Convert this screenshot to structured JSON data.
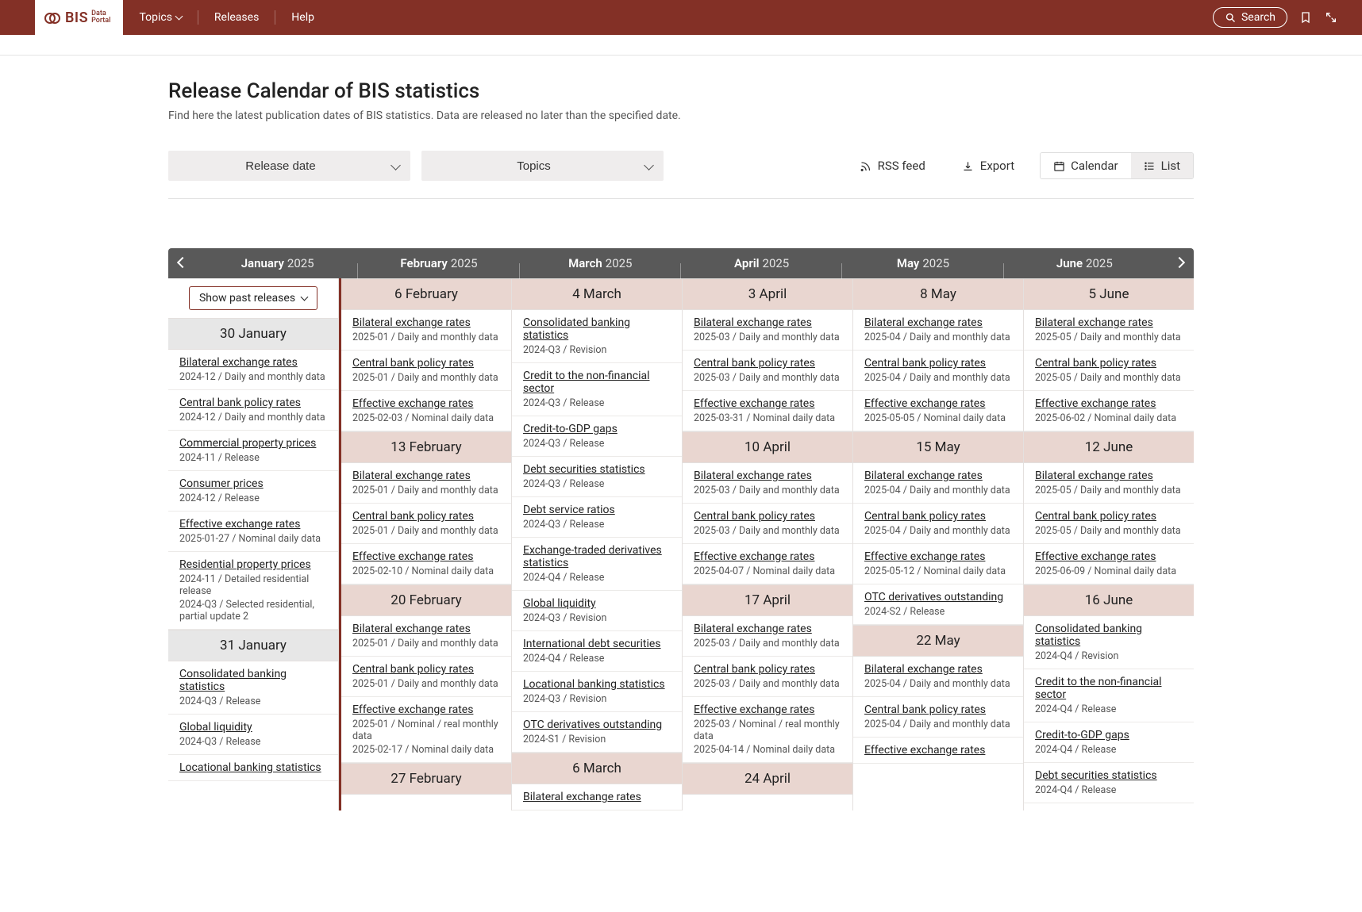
{
  "nav": {
    "brand_main": "BIS",
    "brand_sub1": "Data",
    "brand_sub2": "Portal",
    "topics": "Topics",
    "releases": "Releases",
    "help": "Help",
    "search": "Search"
  },
  "page": {
    "title": "Release Calendar of BIS statistics",
    "subtitle": "Find here the latest publication dates of BIS statistics. Data are released no later than the specified date."
  },
  "filters": {
    "release_date": "Release date",
    "topics": "Topics",
    "rss": "RSS feed",
    "export": "Export",
    "calendar": "Calendar",
    "list": "List"
  },
  "calendar": {
    "show_past": "Show past releases",
    "months": [
      {
        "name": "January",
        "year": "2025"
      },
      {
        "name": "February",
        "year": "2025"
      },
      {
        "name": "March",
        "year": "2025"
      },
      {
        "name": "April",
        "year": "2025"
      },
      {
        "name": "May",
        "year": "2025"
      },
      {
        "name": "June",
        "year": "2025"
      }
    ],
    "columns": [
      {
        "special": "past_toggle",
        "groups": [
          {
            "date": "30 January",
            "muted": true,
            "items": [
              {
                "t": "Bilateral exchange rates",
                "m": [
                  "2024-12 / Daily and monthly data"
                ]
              },
              {
                "t": "Central bank policy rates",
                "m": [
                  "2024-12 / Daily and monthly data"
                ]
              },
              {
                "t": "Commercial property prices",
                "m": [
                  "2024-11 / Release"
                ]
              },
              {
                "t": "Consumer prices",
                "m": [
                  "2024-12 / Release"
                ]
              },
              {
                "t": "Effective exchange rates",
                "m": [
                  "2025-01-27 / Nominal daily data"
                ]
              },
              {
                "t": "Residential property prices",
                "m": [
                  "2024-11 / Detailed residential release",
                  "2024-Q3 / Selected residential, partial update 2"
                ]
              }
            ]
          },
          {
            "date": "31 January",
            "muted": true,
            "items": [
              {
                "t": "Consolidated banking statistics",
                "m": [
                  "2024-Q3 / Release"
                ]
              },
              {
                "t": "Global liquidity",
                "m": [
                  "2024-Q3 / Release"
                ]
              },
              {
                "t": "Locational banking statistics",
                "m": []
              }
            ]
          }
        ]
      },
      {
        "groups": [
          {
            "date": "6 February",
            "items": [
              {
                "t": "Bilateral exchange rates",
                "m": [
                  "2025-01 / Daily and monthly data"
                ]
              },
              {
                "t": "Central bank policy rates",
                "m": [
                  "2025-01 / Daily and monthly data"
                ]
              },
              {
                "t": "Effective exchange rates",
                "m": [
                  "2025-02-03 / Nominal daily data"
                ]
              }
            ]
          },
          {
            "date": "13 February",
            "items": [
              {
                "t": "Bilateral exchange rates",
                "m": [
                  "2025-01 / Daily and monthly data"
                ]
              },
              {
                "t": "Central bank policy rates",
                "m": [
                  "2025-01 / Daily and monthly data"
                ]
              },
              {
                "t": "Effective exchange rates",
                "m": [
                  "2025-02-10 / Nominal daily data"
                ]
              }
            ]
          },
          {
            "date": "20 February",
            "items": [
              {
                "t": "Bilateral exchange rates",
                "m": [
                  "2025-01 / Daily and monthly data"
                ]
              },
              {
                "t": "Central bank policy rates",
                "m": [
                  "2025-01 / Daily and monthly data"
                ]
              },
              {
                "t": "Effective exchange rates",
                "m": [
                  "2025-01 / Nominal / real monthly data",
                  "2025-02-17 / Nominal daily data"
                ]
              }
            ]
          },
          {
            "date": "27 February",
            "items": []
          }
        ]
      },
      {
        "groups": [
          {
            "date": "4 March",
            "items": [
              {
                "t": "Consolidated banking statistics",
                "m": [
                  "2024-Q3 / Revision"
                ]
              },
              {
                "t": "Credit to the non-financial sector",
                "m": [
                  "2024-Q3 / Release"
                ]
              },
              {
                "t": "Credit-to-GDP gaps",
                "m": [
                  "2024-Q3 / Release"
                ]
              },
              {
                "t": "Debt securities statistics",
                "m": [
                  "2024-Q3 / Release"
                ]
              },
              {
                "t": "Debt service ratios",
                "m": [
                  "2024-Q3 / Release"
                ]
              },
              {
                "t": "Exchange-traded derivatives statistics",
                "m": [
                  "2024-Q4 / Release"
                ]
              },
              {
                "t": "Global liquidity",
                "m": [
                  "2024-Q3 / Revision"
                ]
              },
              {
                "t": "International debt securities",
                "m": [
                  "2024-Q4 / Release"
                ]
              },
              {
                "t": "Locational banking statistics",
                "m": [
                  "2024-Q3 / Revision"
                ]
              },
              {
                "t": "OTC derivatives outstanding",
                "m": [
                  "2024-S1 / Revision"
                ]
              }
            ]
          },
          {
            "date": "6 March",
            "items": [
              {
                "t": "Bilateral exchange rates",
                "m": []
              }
            ]
          }
        ]
      },
      {
        "groups": [
          {
            "date": "3 April",
            "items": [
              {
                "t": "Bilateral exchange rates",
                "m": [
                  "2025-03 / Daily and monthly data"
                ]
              },
              {
                "t": "Central bank policy rates",
                "m": [
                  "2025-03 / Daily and monthly data"
                ]
              },
              {
                "t": "Effective exchange rates",
                "m": [
                  "2025-03-31 / Nominal daily data"
                ]
              }
            ]
          },
          {
            "date": "10 April",
            "items": [
              {
                "t": "Bilateral exchange rates",
                "m": [
                  "2025-03 / Daily and monthly data"
                ]
              },
              {
                "t": "Central bank policy rates",
                "m": [
                  "2025-03 / Daily and monthly data"
                ]
              },
              {
                "t": "Effective exchange rates",
                "m": [
                  "2025-04-07 / Nominal daily data"
                ]
              }
            ]
          },
          {
            "date": "17 April",
            "items": [
              {
                "t": "Bilateral exchange rates",
                "m": [
                  "2025-03 / Daily and monthly data"
                ]
              },
              {
                "t": "Central bank policy rates",
                "m": [
                  "2025-03 / Daily and monthly data"
                ]
              },
              {
                "t": "Effective exchange rates",
                "m": [
                  "2025-03 / Nominal / real monthly data",
                  "2025-04-14 / Nominal daily data"
                ]
              }
            ]
          },
          {
            "date": "24 April",
            "items": []
          }
        ]
      },
      {
        "groups": [
          {
            "date": "8 May",
            "items": [
              {
                "t": "Bilateral exchange rates",
                "m": [
                  "2025-04 / Daily and monthly data"
                ]
              },
              {
                "t": "Central bank policy rates",
                "m": [
                  "2025-04 / Daily and monthly data"
                ]
              },
              {
                "t": "Effective exchange rates",
                "m": [
                  "2025-05-05 / Nominal daily data"
                ]
              }
            ]
          },
          {
            "date": "15 May",
            "items": [
              {
                "t": "Bilateral exchange rates",
                "m": [
                  "2025-04 / Daily and monthly data"
                ]
              },
              {
                "t": "Central bank policy rates",
                "m": [
                  "2025-04 / Daily and monthly data"
                ]
              },
              {
                "t": "Effective exchange rates",
                "m": [
                  "2025-05-12 / Nominal daily data"
                ]
              },
              {
                "t": "OTC derivatives outstanding",
                "m": [
                  "2024-S2 / Release"
                ]
              }
            ]
          },
          {
            "date": "22 May",
            "items": [
              {
                "t": "Bilateral exchange rates",
                "m": [
                  "2025-04 / Daily and monthly data"
                ]
              },
              {
                "t": "Central bank policy rates",
                "m": [
                  "2025-04 / Daily and monthly data"
                ]
              },
              {
                "t": "Effective exchange rates",
                "m": []
              }
            ]
          }
        ]
      },
      {
        "groups": [
          {
            "date": "5 June",
            "items": [
              {
                "t": "Bilateral exchange rates",
                "m": [
                  "2025-05 / Daily and monthly data"
                ]
              },
              {
                "t": "Central bank policy rates",
                "m": [
                  "2025-05 / Daily and monthly data"
                ]
              },
              {
                "t": "Effective exchange rates",
                "m": [
                  "2025-06-02 / Nominal daily data"
                ]
              }
            ]
          },
          {
            "date": "12 June",
            "items": [
              {
                "t": "Bilateral exchange rates",
                "m": [
                  "2025-05 / Daily and monthly data"
                ]
              },
              {
                "t": "Central bank policy rates",
                "m": [
                  "2025-05 / Daily and monthly data"
                ]
              },
              {
                "t": "Effective exchange rates",
                "m": [
                  "2025-06-09 / Nominal daily data"
                ]
              }
            ]
          },
          {
            "date": "16 June",
            "items": [
              {
                "t": "Consolidated banking statistics",
                "m": [
                  "2024-Q4 / Revision"
                ]
              },
              {
                "t": "Credit to the non-financial sector",
                "m": [
                  "2024-Q4 / Release"
                ]
              },
              {
                "t": "Credit-to-GDP gaps",
                "m": [
                  "2024-Q4 / Release"
                ]
              },
              {
                "t": "Debt securities statistics",
                "m": [
                  "2024-Q4 / Release"
                ]
              }
            ]
          }
        ]
      }
    ]
  }
}
